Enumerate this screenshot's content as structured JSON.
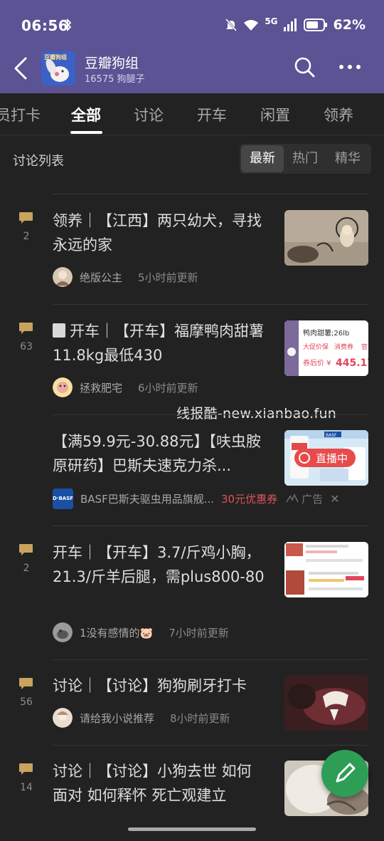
{
  "status": {
    "time": "06:56",
    "network": "5G",
    "battery": "62%"
  },
  "header": {
    "avatar_text": "豆瓣狗组",
    "group_name": "豆瓣狗组",
    "members": "16575 狗腿子"
  },
  "tabs": [
    "员打卡",
    "全部",
    "讨论",
    "开车",
    "闲置",
    "领养"
  ],
  "list": {
    "title": "讨论列表",
    "sort": [
      "最新",
      "热门",
      "精华"
    ]
  },
  "posts": [
    {
      "count": "2",
      "title": "领养｜【江西】两只幼犬，寻找永远的家",
      "user": "绝版公主",
      "ago": "5小时前更新"
    },
    {
      "count": "63",
      "title": "开车｜【开车】福摩鸭肉甜薯11.8kg最低430",
      "user": "拯救肥宅",
      "ago": "6小时前更新",
      "thumb_texts": [
        "鸭肉甜薯;26lb",
        "大促价保",
        "消费券",
        "官",
        "券后价 ¥",
        "445.17"
      ]
    },
    {
      "count": "2",
      "title": "开车｜【开车】3.7/斤鸡小胸，21.3/斤羊后腿，需plus800-80",
      "user": "1没有感情的🐷",
      "ago": "7小时前更新"
    },
    {
      "count": "56",
      "title": "讨论｜【讨论】狗狗刷牙打卡",
      "user": "请给我小说推荐",
      "ago": "8小时前更新"
    },
    {
      "count": "14",
      "title": "讨论｜【讨论】小狗去世 如何面对 如何释怀 死亡观建立"
    }
  ],
  "ad": {
    "title": "【满59.9元-30.88元】【呋虫胺原研药】巴斯夫速克力杀...",
    "shop_logo": "D·BASF",
    "shop": "BASF巴斯夫驱虫用品旗舰...",
    "coupon": "30元优惠券",
    "label": "广告",
    "live": "直播中",
    "thumb_logo": "BASF"
  },
  "watermark": "线报酷-new.xianbao.fun",
  "colors": {
    "header_bg": "#5b5393",
    "page_bg": "#222222",
    "fab": "#2e9e57",
    "coupon": "#e0525a",
    "comment": "#c9a25e"
  }
}
